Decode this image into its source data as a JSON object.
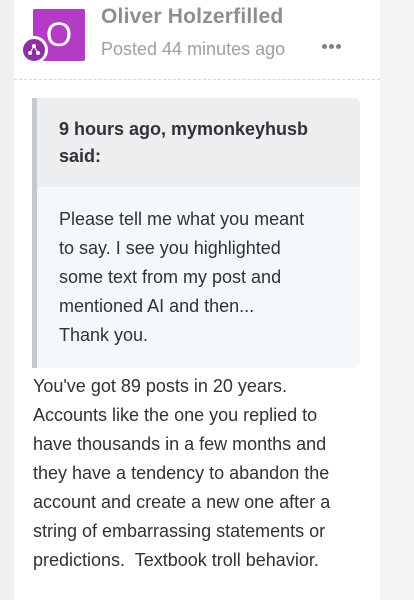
{
  "post": {
    "avatar_letter": "O",
    "author": "Oliver Holzerfilled",
    "posted": "Posted 44 minutes ago"
  },
  "quote": {
    "header_lines": [
      "9 hours ago, mymonkeyhusb",
      "said:"
    ],
    "body_lines": [
      "Please tell me what you meant",
      "to say. I see you highlighted",
      "some text from my post and",
      "mentioned AI and then...",
      "Thank you."
    ]
  },
  "reply": {
    "lines": [
      "You've got 89 posts in 20 years.",
      "Accounts like the one you replied to",
      "have thousands in a few months and",
      "they have a tendency to abandon the",
      "account and create a new one after a",
      "string of embarrassing statements or",
      "predictions.  Textbook troll behavior."
    ]
  },
  "colors": {
    "avatar": "#b43bc6",
    "badge": "#8e2fa8",
    "quote_bg": "#f5f8fb",
    "quote_header_bg": "#edeef0"
  },
  "icons": [
    "community-badge-icon",
    "more-options-icon"
  ]
}
